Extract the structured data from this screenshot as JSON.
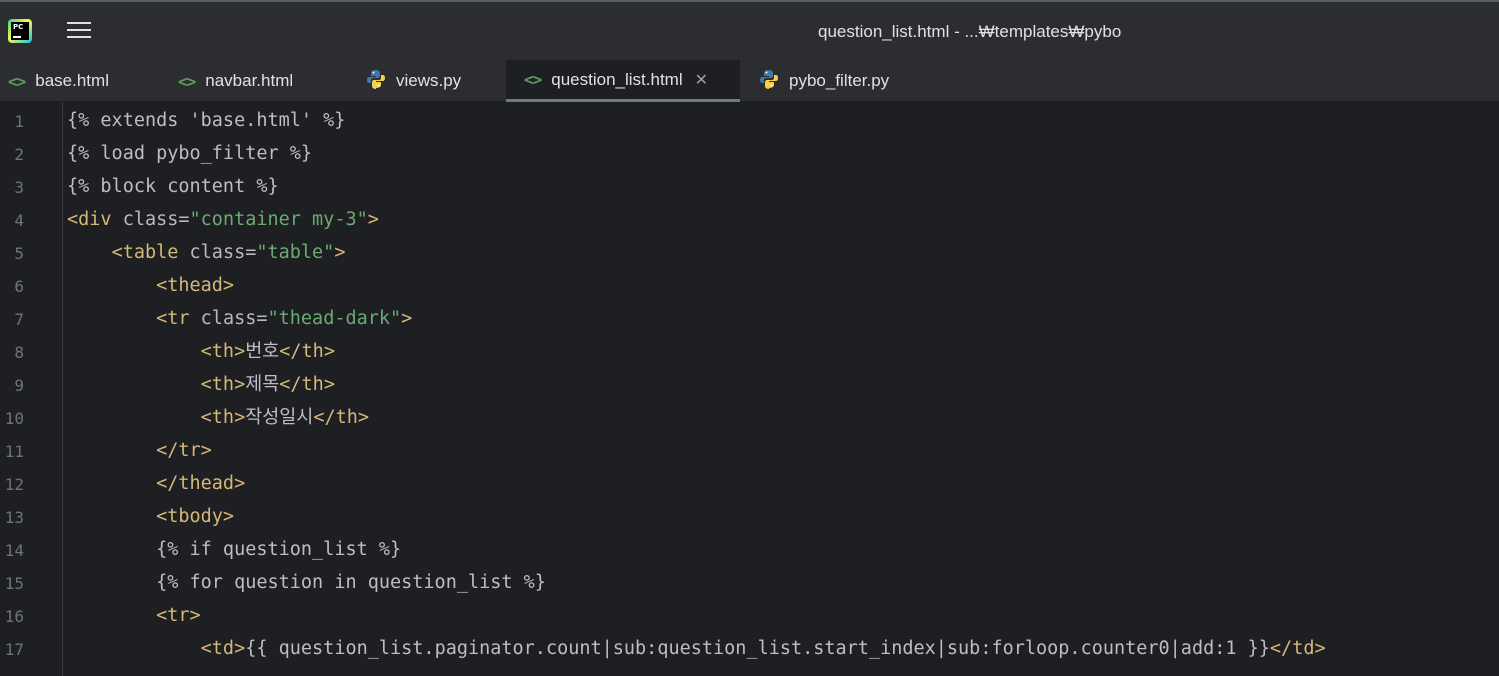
{
  "window": {
    "title": "question_list.html - ...₩templates₩pybo"
  },
  "icons": {
    "app": "pycharm-logo-icon",
    "menu": "hamburger-menu-icon",
    "html": "html-file-icon",
    "python": "python-file-icon",
    "close": "close-icon"
  },
  "tabs": [
    {
      "label": "base.html",
      "icon": "html"
    },
    {
      "label": "navbar.html",
      "icon": "html"
    },
    {
      "label": "views.py",
      "icon": "python"
    },
    {
      "label": "question_list.html",
      "icon": "html",
      "active": true,
      "close": "✕"
    },
    {
      "label": "pybo_filter.py",
      "icon": "python"
    }
  ],
  "editor": {
    "line_numbers": [
      "1",
      "2",
      "3",
      "4",
      "5",
      "6",
      "7",
      "8",
      "9",
      "10",
      "11",
      "12",
      "13",
      "14",
      "15",
      "16",
      "17"
    ],
    "lines": [
      [
        {
          "t": "tpl",
          "v": "{% extends 'base.html' %}"
        }
      ],
      [
        {
          "t": "tpl",
          "v": "{% load pybo_filter %}"
        }
      ],
      [
        {
          "t": "tpl",
          "v": "{% block content %}"
        }
      ],
      [
        {
          "t": "tag",
          "v": "<div "
        },
        {
          "t": "attr",
          "v": "class="
        },
        {
          "t": "str",
          "v": "\"container my-3\""
        },
        {
          "t": "tag",
          "v": ">"
        }
      ],
      [
        {
          "t": "txt",
          "v": "    "
        },
        {
          "t": "tag",
          "v": "<table "
        },
        {
          "t": "attr",
          "v": "class="
        },
        {
          "t": "str",
          "v": "\"table\""
        },
        {
          "t": "tag",
          "v": ">"
        }
      ],
      [
        {
          "t": "txt",
          "v": "        "
        },
        {
          "t": "tag",
          "v": "<thead>"
        }
      ],
      [
        {
          "t": "txt",
          "v": "        "
        },
        {
          "t": "tag",
          "v": "<tr "
        },
        {
          "t": "attr",
          "v": "class="
        },
        {
          "t": "str",
          "v": "\"thead-dark\""
        },
        {
          "t": "tag",
          "v": ">"
        }
      ],
      [
        {
          "t": "txt",
          "v": "            "
        },
        {
          "t": "tag",
          "v": "<th>"
        },
        {
          "t": "txt",
          "v": "번호"
        },
        {
          "t": "tag",
          "v": "</th>"
        }
      ],
      [
        {
          "t": "txt",
          "v": "            "
        },
        {
          "t": "tag",
          "v": "<th>"
        },
        {
          "t": "txt",
          "v": "제목"
        },
        {
          "t": "tag",
          "v": "</th>"
        }
      ],
      [
        {
          "t": "txt",
          "v": "            "
        },
        {
          "t": "tag",
          "v": "<th>"
        },
        {
          "t": "txt",
          "v": "작성일시"
        },
        {
          "t": "tag",
          "v": "</th>"
        }
      ],
      [
        {
          "t": "txt",
          "v": "        "
        },
        {
          "t": "tag",
          "v": "</tr>"
        }
      ],
      [
        {
          "t": "txt",
          "v": "        "
        },
        {
          "t": "tag",
          "v": "</thead>"
        }
      ],
      [
        {
          "t": "txt",
          "v": "        "
        },
        {
          "t": "tag",
          "v": "<tbody>"
        }
      ],
      [
        {
          "t": "txt",
          "v": "        "
        },
        {
          "t": "tpl",
          "v": "{% if question_list %}"
        }
      ],
      [
        {
          "t": "txt",
          "v": "        "
        },
        {
          "t": "tpl",
          "v": "{% for question in question_list %}"
        }
      ],
      [
        {
          "t": "txt",
          "v": "        "
        },
        {
          "t": "tag",
          "v": "<tr>"
        }
      ],
      [
        {
          "t": "txt",
          "v": "            "
        },
        {
          "t": "tag",
          "v": "<td>"
        },
        {
          "t": "tpl",
          "v": "{{ question_list.paginator.count|sub:question_list.start_index|sub:forloop.counter0|add:1 }}"
        },
        {
          "t": "tag",
          "v": "</td>"
        }
      ]
    ]
  }
}
